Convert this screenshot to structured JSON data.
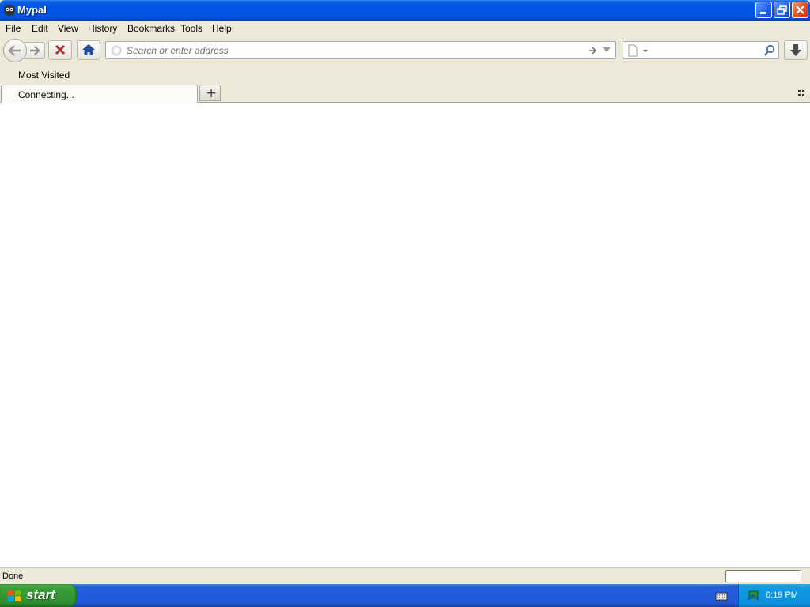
{
  "window": {
    "title": "Mypal"
  },
  "menu": [
    {
      "label": "File"
    },
    {
      "label": "Edit"
    },
    {
      "label": "View"
    },
    {
      "label": "History"
    },
    {
      "label": "Bookmarks"
    },
    {
      "label": "Tools"
    },
    {
      "label": "Help"
    }
  ],
  "navbar": {
    "url_placeholder": "Search or enter address",
    "url_value": "",
    "search_value": ""
  },
  "bookmarks": {
    "items": [
      {
        "label": "Most Visited"
      }
    ]
  },
  "tabs": [
    {
      "label": "Connecting..."
    }
  ],
  "newtab_label": "+",
  "status": {
    "text": "Done"
  },
  "taskbar": {
    "start_label": "start",
    "clock": "6:19 PM"
  },
  "colors": {
    "titlebar": "#0054e3",
    "taskbar": "#245edb",
    "start": "#3a9f3a",
    "tray": "#0f9be6",
    "stop": "#c0262d",
    "home": "#1f4a9b"
  },
  "icons": [
    "app-icon",
    "minimize-icon",
    "restore-icon",
    "close-icon",
    "back-arrow-icon",
    "forward-arrow-icon",
    "stop-icon",
    "home-icon",
    "identity-icon",
    "go-arrow-icon",
    "dropmarker-icon",
    "search-engine-icon",
    "magnifier-icon",
    "download-icon",
    "all-tabs-icon",
    "windows-logo-icon",
    "keyboard-icon",
    "network-icon"
  ]
}
